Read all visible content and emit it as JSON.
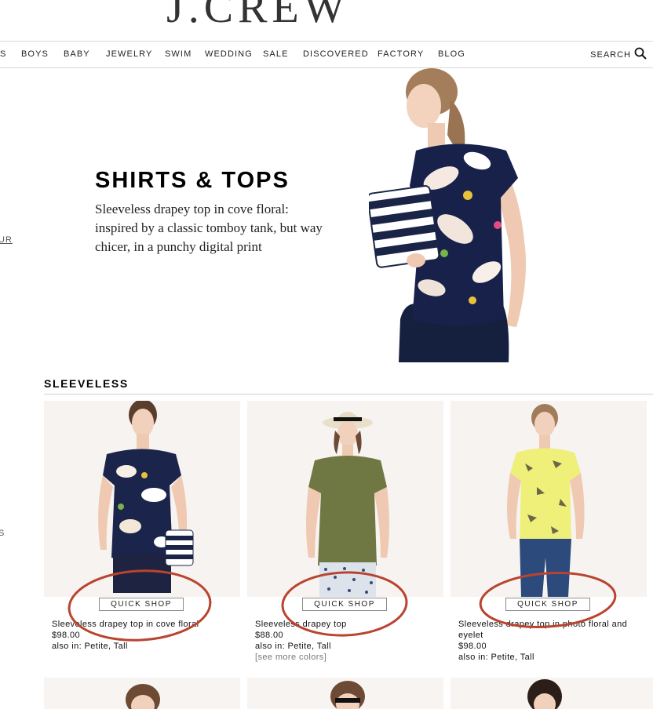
{
  "brand": {
    "logo_text": "J.CREW"
  },
  "nav": {
    "items": [
      "S",
      "BOYS",
      "BABY",
      "JEWELRY",
      "SWIM",
      "WEDDING",
      "SALE",
      "DISCOVERED",
      "FACTORY",
      "BLOG"
    ],
    "search_label": "SEARCH"
  },
  "hero": {
    "title": "SHIRTS & TOPS",
    "description": "Sleeveless drapey top in cove floral: inspired by a classic tomboy tank, but way chicer, in a punchy digital print"
  },
  "edge": {
    "link_text": "UR",
    "side_text": "S"
  },
  "section": {
    "title": "SLEEVELESS"
  },
  "products": [
    {
      "quick_shop": "QUICK SHOP",
      "name": "Sleeveless drapey top in cove floral",
      "price": "$98.00",
      "also": "also in: Petite, Tall",
      "more": ""
    },
    {
      "quick_shop": "QUICK SHOP",
      "name": "Sleeveless drapey top",
      "price": "$88.00",
      "also": "also in: Petite, Tall",
      "more": "[see more colors]"
    },
    {
      "quick_shop": "QUICK SHOP",
      "name_line1": "Sleeveless drapey top in photo floral and",
      "name_line2": "eyelet",
      "price": "$98.00",
      "also": "also in: Petite, Tall",
      "more": ""
    }
  ],
  "colors": {
    "annotation": "#b9442f",
    "nav_border": "#d7d7d7"
  }
}
